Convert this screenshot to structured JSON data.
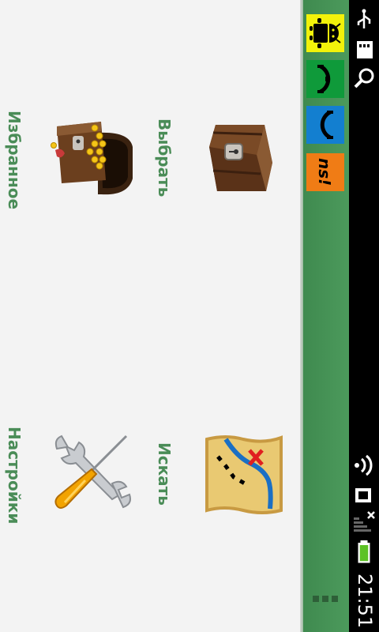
{
  "status_bar": {
    "time": "21:51",
    "icons": [
      "usb-icon",
      "sd-card-icon",
      "search-icon",
      "wifi-icon",
      "sim-icon",
      "signal-icon",
      "battery-icon"
    ]
  },
  "app_panel": {
    "tiles": [
      {
        "name": "android-tile",
        "icon": "android-icon",
        "color": "#f2f20a"
      },
      {
        "name": "green-tile",
        "icon": "arc-icon",
        "color": "#0f9a3a"
      },
      {
        "name": "blue-tile",
        "icon": "arc-icon",
        "color": "#137fd0"
      },
      {
        "name": "orange-tile",
        "icon": "lettering-icon",
        "color": "#f07c15",
        "text": "ns!"
      }
    ]
  },
  "menu": {
    "items": [
      {
        "label": "Выбрать",
        "icon": "treasure-chest-icon"
      },
      {
        "label": "Искать",
        "icon": "treasure-map-icon"
      },
      {
        "label": "Избранное",
        "icon": "open-chest-gold-icon"
      },
      {
        "label": "Настройки",
        "icon": "wrench-screwdriver-icon"
      }
    ]
  },
  "colors": {
    "accent_text": "#4a8c57",
    "panel": "#4c9a5c",
    "background": "#f3f3f3"
  }
}
